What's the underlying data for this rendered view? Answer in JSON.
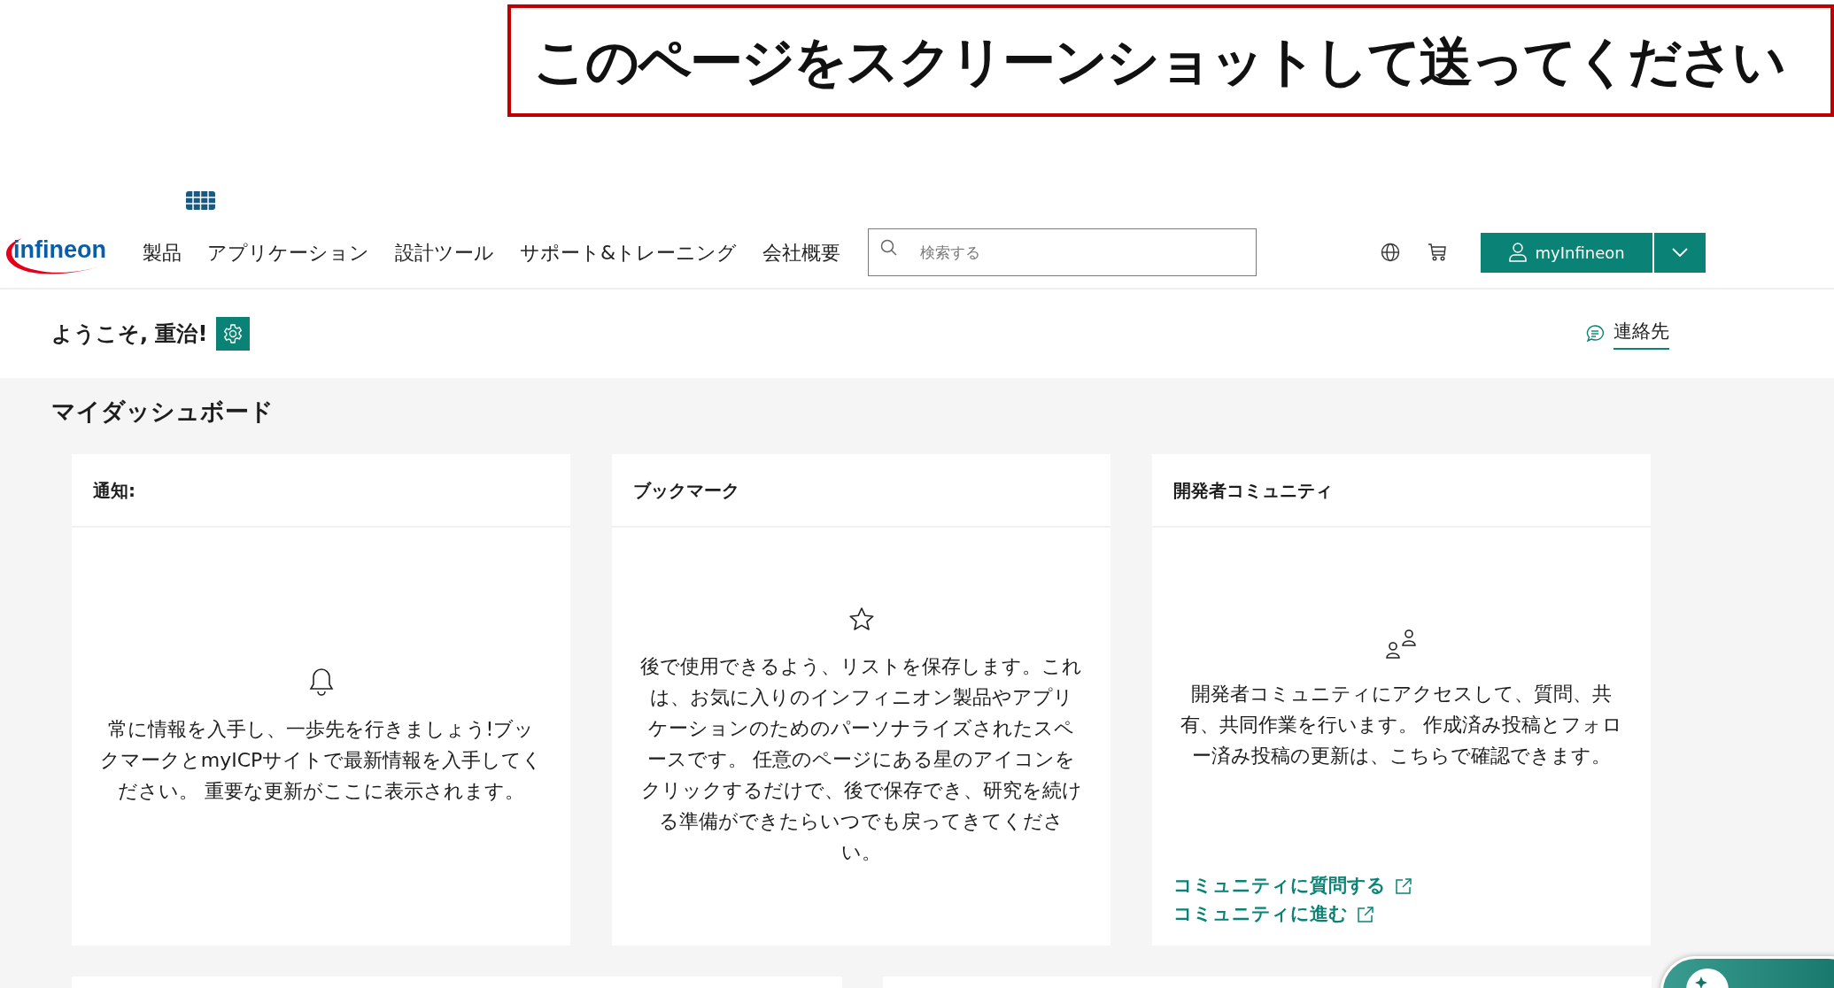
{
  "annotation": {
    "text": "このページをスクリーンショットして送ってください"
  },
  "header": {
    "logo": "infineon",
    "nav": [
      {
        "label": "製品"
      },
      {
        "label": "アプリケーション"
      },
      {
        "label": "設計ツール"
      },
      {
        "label": "サポート&トレーニング"
      },
      {
        "label": "会社概要"
      }
    ],
    "search": {
      "placeholder": "検索する"
    },
    "account_button": {
      "label": "myInfineon"
    }
  },
  "welcome": {
    "greeting": "ようこそ, 重治!",
    "contact": "連絡先"
  },
  "dashboard": {
    "title": "マイダッシュボード",
    "cards": [
      {
        "kind": "notifications",
        "title": "通知:",
        "text": "常に情報を入手し、一歩先を行きましょう!ブックマークとmyICPサイトで最新情報を入手してください。 重要な更新がここに表示されます。"
      },
      {
        "kind": "bookmarks",
        "title": "ブックマーク",
        "text": "後で使用できるよう、リストを保存します。これは、お気に入りのインフィニオン製品やアプリケーションのためのパーソナライズされたスペースです。 任意のページにある星のアイコンをクリックするだけで、後で保存でき、研究を続ける準備ができたらいつでも戻ってきてください。"
      },
      {
        "kind": "community",
        "title": "開発者コミュニティ",
        "text": "開発者コミュニティにアクセスして、質問、共有、共同作業を行います。 作成済み投稿とフォロー済み投稿の更新は、こちらで確認できます。",
        "links": [
          {
            "label": "コミュニティに質問する"
          },
          {
            "label": "コミュニティに進む"
          }
        ]
      }
    ]
  }
}
